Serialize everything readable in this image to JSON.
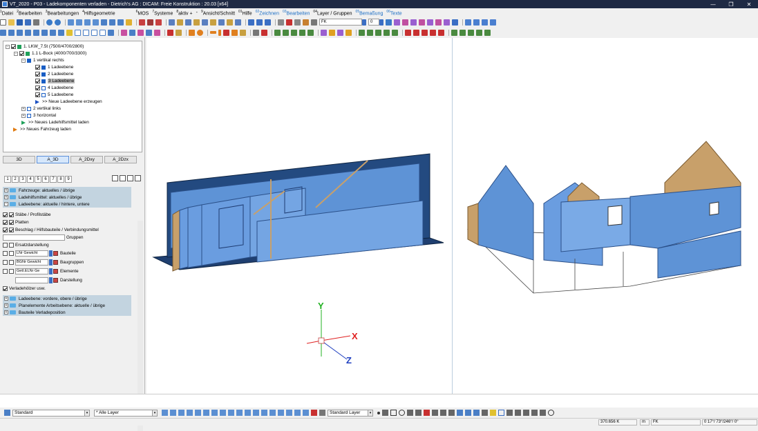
{
  "window": {
    "title": "VT_2020 - P03 - Ladekomponenten verladen - Dietrich's AG : DICAM: Freie Konstruktion : 20.03 [x64]",
    "minimize": "—",
    "maximize": "❐",
    "close": "✕"
  },
  "menu": [
    {
      "num": "1",
      "label": "Datei",
      "blue": false
    },
    {
      "num": "2",
      "label": "Bearbeiten",
      "blue": false
    },
    {
      "num": "3",
      "label": "Bearbeitungen",
      "blue": false
    },
    {
      "num": "4",
      "label": "Hilfsgeometrie",
      "blue": false
    },
    {
      "num": "6",
      "label": "MOS",
      "blue": false
    },
    {
      "num": "7",
      "label": "Systeme",
      "blue": false
    },
    {
      "num": "8",
      "label": "aktiv +",
      "blue": false
    },
    {
      "num": "-",
      "label": "",
      "blue": false
    },
    {
      "num": "9",
      "label": "Ansicht/Schnitt",
      "blue": false
    },
    {
      "num": "01",
      "label": "Hilfe",
      "blue": false
    },
    {
      "num": "02",
      "label": "Zeichnen",
      "blue": true
    },
    {
      "num": "03",
      "label": "Bearbeiten",
      "blue": true
    },
    {
      "num": "04",
      "label": "Layer / Gruppen",
      "blue": false
    },
    {
      "num": "05",
      "label": "Bemaßung",
      "blue": true
    },
    {
      "num": "06",
      "label": "Texte",
      "blue": true
    }
  ],
  "toolbar": {
    "combo1": "FK",
    "combo2": "0"
  },
  "tree": {
    "nodes": [
      {
        "label": "1. LKW_7.5t (7500/4700/2800)"
      },
      {
        "label": "1.1 L-Bock (4000/700/3300)"
      },
      {
        "label": "1 vertikal rechts"
      },
      {
        "label": "1 Ladeebene"
      },
      {
        "label": "2 Ladeebene"
      },
      {
        "label": "3 Ladeebene"
      },
      {
        "label": "4 Ladeebene"
      },
      {
        "label": "5 Ladeebene"
      },
      {
        "label": ">> Neue Ladeebene erzeugen"
      },
      {
        "label": "2 vertikal links"
      },
      {
        "label": "3 horizontal"
      },
      {
        "label": ">> Neues Ladehilfsmittel laden"
      },
      {
        "label": ">> Neues Fahrzeug laden"
      }
    ]
  },
  "viewTabs": [
    "3D",
    "A_3D",
    "A_2Dxy",
    "A_2Dzx"
  ],
  "activeViewTab": "A_3D",
  "numberTabs": [
    "1",
    "2",
    "3",
    "4",
    "5",
    "6",
    "7",
    "8",
    "9"
  ],
  "props": {
    "groupsTop": [
      "Fahrzeuge: aktuelles / übrige",
      "Ladehilfsmittel: aktuelles / übrige",
      "Ladeebene: aktuelle / hintere, untere"
    ],
    "checks": [
      "Stäbe / Profilstäbe",
      "Platten",
      "Beschlag / Hilfsbauteile / Verbindungsmittel"
    ],
    "gruppen": "Gruppen",
    "ersatz": "Ersatzdarstellung",
    "rows": [
      {
        "value": "LNr Gewicht",
        "label": "Bauteile"
      },
      {
        "value": "BGNr Gewicht",
        "label": "Baugruppen"
      },
      {
        "value": "GetI.ELNr Ge",
        "label": "Elemente"
      },
      {
        "value": "",
        "label": "Darstellung"
      }
    ],
    "verlade": "Verladehölzer usw.",
    "groupsBottom": [
      "Ladeebene: vordere, obere / übrige",
      "Planelemente Arbeitsebene: aktuelle / übrige",
      "Bauteile Verladeposition"
    ]
  },
  "axes": {
    "y": "Y",
    "x": "X",
    "z": "Z"
  },
  "bottom": {
    "style": "Standard",
    "layer": "* Alle Layer",
    "standardLayer": "Standard Layer"
  },
  "status": {
    "value": "370.656 K",
    "unit": "m",
    "mode": "FK",
    "angles": "0 17°/ 73°/246°/  0°"
  },
  "colors": {
    "panelBlue": "#4a7fc6",
    "deepBlue": "#1f3f70",
    "wood": "#c8a06a",
    "axisX": "#e02020",
    "axisY": "#20b020",
    "axisZ": "#2040c0"
  }
}
